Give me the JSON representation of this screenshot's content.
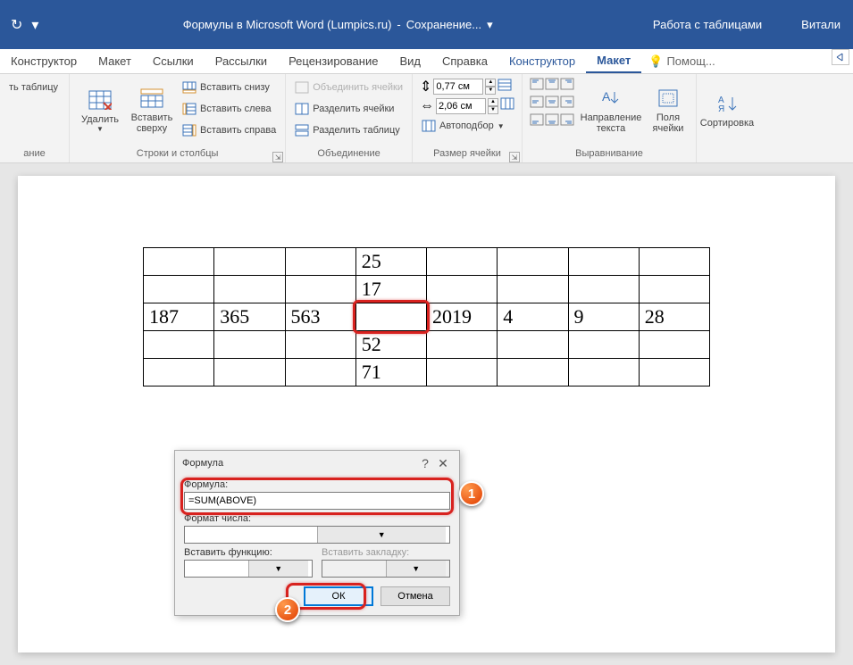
{
  "titlebar": {
    "doc_title": "Формулы в Microsoft Word (Lumpics.ru)",
    "saving": "Сохранение...",
    "context_tab": "Работа с таблицами",
    "account": "Витали"
  },
  "tabs": {
    "konstruktor1": "Конструктор",
    "maket1": "Макет",
    "ssylki": "Ссылки",
    "rassylki": "Рассылки",
    "retsenz": "Рецензирование",
    "vid": "Вид",
    "spravka": "Справка",
    "konstruktor2": "Конструктор",
    "maket2": "Макет",
    "help": "Помощ..."
  },
  "ribbon": {
    "g_table_label": "ание",
    "draw_table": "ть таблицу",
    "delete": "Удалить",
    "insert_above": "Вставить сверху",
    "insert_below": "Вставить снизу",
    "insert_left": "Вставить слева",
    "insert_right": "Вставить справа",
    "g_rows_cols": "Строки и столбцы",
    "merge": "Объединить ячейки",
    "split": "Разделить ячейки",
    "split_table": "Разделить таблицу",
    "g_merge": "Объединение",
    "h_val": "0,77 см",
    "w_val": "2,06 см",
    "autofit": "Автоподбор",
    "g_size": "Размер ячейки",
    "text_dir": "Направление текста",
    "cell_margins": "Поля ячейки",
    "g_align": "Выравнивание",
    "sort": "Сортировка"
  },
  "table": {
    "r1": [
      "",
      "",
      "",
      "25",
      "",
      "",
      "",
      ""
    ],
    "r2": [
      "",
      "",
      "",
      "17",
      "",
      "",
      "",
      ""
    ],
    "r3": [
      "187",
      "365",
      "563",
      "",
      "2019",
      "4",
      "9",
      "28"
    ],
    "r4": [
      "",
      "",
      "",
      "52",
      "",
      "",
      "",
      ""
    ],
    "r5": [
      "",
      "",
      "",
      "71",
      "",
      "",
      "",
      ""
    ]
  },
  "dialog": {
    "title": "Формула",
    "formula_label": "Формула:",
    "formula_value": "=SUM(ABOVE)",
    "numfmt_label": "Формат числа:",
    "insert_fn_label": "Вставить функцию:",
    "insert_bm_label": "Вставить закладку:",
    "ok": "ОК",
    "cancel": "Отмена"
  },
  "annotations": {
    "one": "1",
    "two": "2"
  }
}
